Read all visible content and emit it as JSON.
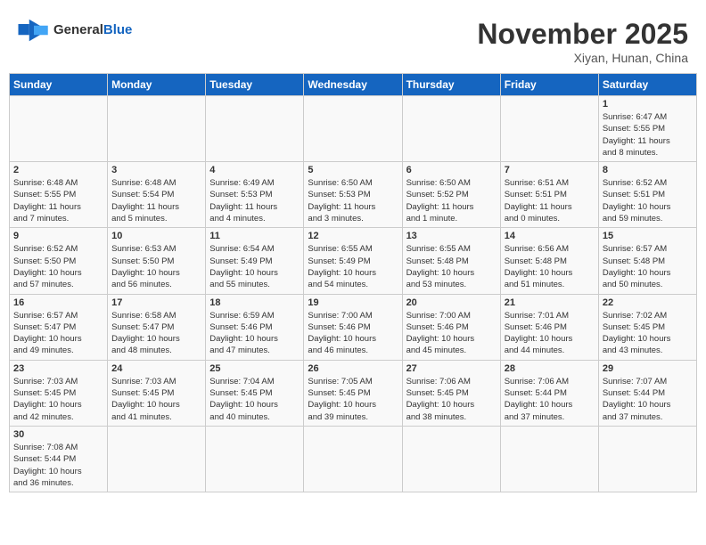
{
  "header": {
    "logo_general": "General",
    "logo_blue": "Blue",
    "month_title": "November 2025",
    "location": "Xiyan, Hunan, China"
  },
  "days_of_week": [
    "Sunday",
    "Monday",
    "Tuesday",
    "Wednesday",
    "Thursday",
    "Friday",
    "Saturday"
  ],
  "weeks": [
    [
      {
        "day": "",
        "info": ""
      },
      {
        "day": "",
        "info": ""
      },
      {
        "day": "",
        "info": ""
      },
      {
        "day": "",
        "info": ""
      },
      {
        "day": "",
        "info": ""
      },
      {
        "day": "",
        "info": ""
      },
      {
        "day": "1",
        "info": "Sunrise: 6:47 AM\nSunset: 5:55 PM\nDaylight: 11 hours\nand 8 minutes."
      }
    ],
    [
      {
        "day": "2",
        "info": "Sunrise: 6:48 AM\nSunset: 5:55 PM\nDaylight: 11 hours\nand 7 minutes."
      },
      {
        "day": "3",
        "info": "Sunrise: 6:48 AM\nSunset: 5:54 PM\nDaylight: 11 hours\nand 5 minutes."
      },
      {
        "day": "4",
        "info": "Sunrise: 6:49 AM\nSunset: 5:53 PM\nDaylight: 11 hours\nand 4 minutes."
      },
      {
        "day": "5",
        "info": "Sunrise: 6:50 AM\nSunset: 5:53 PM\nDaylight: 11 hours\nand 3 minutes."
      },
      {
        "day": "6",
        "info": "Sunrise: 6:50 AM\nSunset: 5:52 PM\nDaylight: 11 hours\nand 1 minute."
      },
      {
        "day": "7",
        "info": "Sunrise: 6:51 AM\nSunset: 5:51 PM\nDaylight: 11 hours\nand 0 minutes."
      },
      {
        "day": "8",
        "info": "Sunrise: 6:52 AM\nSunset: 5:51 PM\nDaylight: 10 hours\nand 59 minutes."
      }
    ],
    [
      {
        "day": "9",
        "info": "Sunrise: 6:52 AM\nSunset: 5:50 PM\nDaylight: 10 hours\nand 57 minutes."
      },
      {
        "day": "10",
        "info": "Sunrise: 6:53 AM\nSunset: 5:50 PM\nDaylight: 10 hours\nand 56 minutes."
      },
      {
        "day": "11",
        "info": "Sunrise: 6:54 AM\nSunset: 5:49 PM\nDaylight: 10 hours\nand 55 minutes."
      },
      {
        "day": "12",
        "info": "Sunrise: 6:55 AM\nSunset: 5:49 PM\nDaylight: 10 hours\nand 54 minutes."
      },
      {
        "day": "13",
        "info": "Sunrise: 6:55 AM\nSunset: 5:48 PM\nDaylight: 10 hours\nand 53 minutes."
      },
      {
        "day": "14",
        "info": "Sunrise: 6:56 AM\nSunset: 5:48 PM\nDaylight: 10 hours\nand 51 minutes."
      },
      {
        "day": "15",
        "info": "Sunrise: 6:57 AM\nSunset: 5:48 PM\nDaylight: 10 hours\nand 50 minutes."
      }
    ],
    [
      {
        "day": "16",
        "info": "Sunrise: 6:57 AM\nSunset: 5:47 PM\nDaylight: 10 hours\nand 49 minutes."
      },
      {
        "day": "17",
        "info": "Sunrise: 6:58 AM\nSunset: 5:47 PM\nDaylight: 10 hours\nand 48 minutes."
      },
      {
        "day": "18",
        "info": "Sunrise: 6:59 AM\nSunset: 5:46 PM\nDaylight: 10 hours\nand 47 minutes."
      },
      {
        "day": "19",
        "info": "Sunrise: 7:00 AM\nSunset: 5:46 PM\nDaylight: 10 hours\nand 46 minutes."
      },
      {
        "day": "20",
        "info": "Sunrise: 7:00 AM\nSunset: 5:46 PM\nDaylight: 10 hours\nand 45 minutes."
      },
      {
        "day": "21",
        "info": "Sunrise: 7:01 AM\nSunset: 5:46 PM\nDaylight: 10 hours\nand 44 minutes."
      },
      {
        "day": "22",
        "info": "Sunrise: 7:02 AM\nSunset: 5:45 PM\nDaylight: 10 hours\nand 43 minutes."
      }
    ],
    [
      {
        "day": "23",
        "info": "Sunrise: 7:03 AM\nSunset: 5:45 PM\nDaylight: 10 hours\nand 42 minutes."
      },
      {
        "day": "24",
        "info": "Sunrise: 7:03 AM\nSunset: 5:45 PM\nDaylight: 10 hours\nand 41 minutes."
      },
      {
        "day": "25",
        "info": "Sunrise: 7:04 AM\nSunset: 5:45 PM\nDaylight: 10 hours\nand 40 minutes."
      },
      {
        "day": "26",
        "info": "Sunrise: 7:05 AM\nSunset: 5:45 PM\nDaylight: 10 hours\nand 39 minutes."
      },
      {
        "day": "27",
        "info": "Sunrise: 7:06 AM\nSunset: 5:45 PM\nDaylight: 10 hours\nand 38 minutes."
      },
      {
        "day": "28",
        "info": "Sunrise: 7:06 AM\nSunset: 5:44 PM\nDaylight: 10 hours\nand 37 minutes."
      },
      {
        "day": "29",
        "info": "Sunrise: 7:07 AM\nSunset: 5:44 PM\nDaylight: 10 hours\nand 37 minutes."
      }
    ],
    [
      {
        "day": "30",
        "info": "Sunrise: 7:08 AM\nSunset: 5:44 PM\nDaylight: 10 hours\nand 36 minutes."
      },
      {
        "day": "",
        "info": ""
      },
      {
        "day": "",
        "info": ""
      },
      {
        "day": "",
        "info": ""
      },
      {
        "day": "",
        "info": ""
      },
      {
        "day": "",
        "info": ""
      },
      {
        "day": "",
        "info": ""
      }
    ]
  ]
}
